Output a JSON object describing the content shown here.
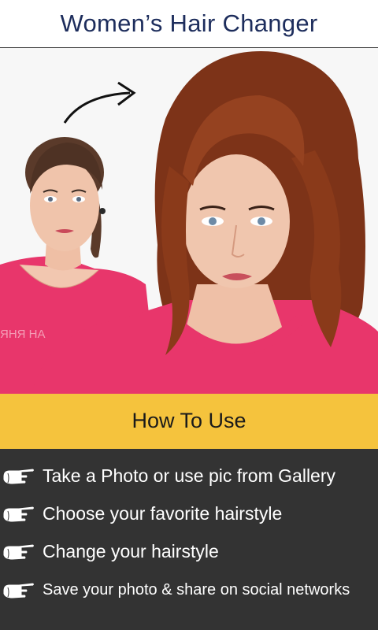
{
  "app": {
    "title": "Women’s Hair Changer"
  },
  "hero": {
    "description_icons": [
      "before-photo-person",
      "after-photo-person",
      "curved-arrow-icon"
    ]
  },
  "howto": {
    "label": "How To Use"
  },
  "steps": [
    {
      "icon": "pointing-hand-icon",
      "label": "Take a Photo or use pic from Gallery"
    },
    {
      "icon": "pointing-hand-icon",
      "label": "Choose your favorite hairstyle"
    },
    {
      "icon": "pointing-hand-icon",
      "label": "Change your hairstyle"
    },
    {
      "icon": "pointing-hand-icon",
      "label": "Save your photo & share on social networks"
    }
  ],
  "colors": {
    "title_text": "#1d2d5c",
    "howto_bg": "#f5c33d",
    "steps_bg": "#333333",
    "shirt_pink": "#e8366b",
    "hair_brown": "#8a3a1a"
  }
}
